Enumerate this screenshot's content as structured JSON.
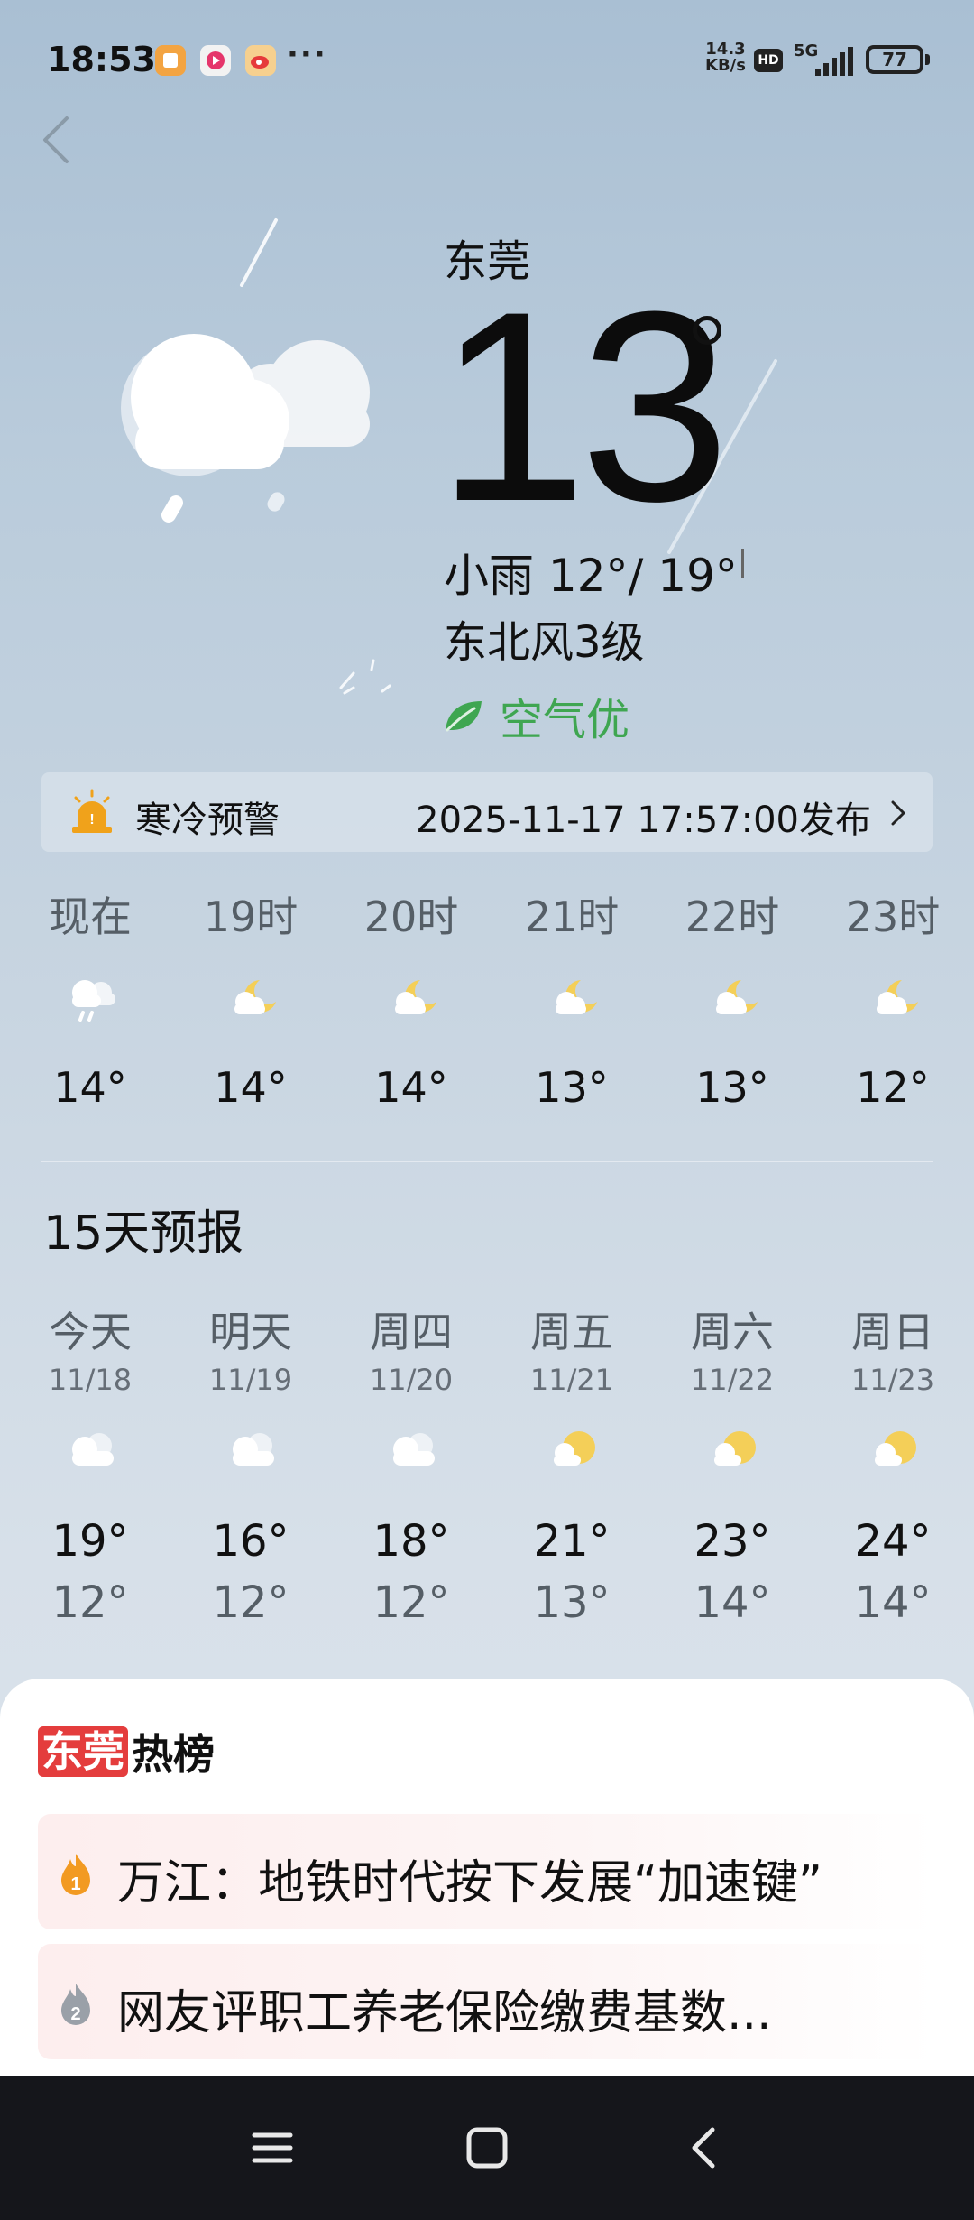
{
  "status_bar": {
    "time": "18:53",
    "net_speed_value": "14.3",
    "net_speed_unit": "KB/s",
    "hd_label": "HD",
    "network": "5G",
    "battery": "77",
    "more_icon": "···"
  },
  "current": {
    "city": "东莞",
    "temperature": "13",
    "condition": "小雨 12°/ 19°",
    "wind": "东北风3级",
    "air_quality": "空气优",
    "weather_icon": "cloud-rain-icon"
  },
  "warning": {
    "title": "寒冷预警",
    "published": "2025-11-17 17:57:00发布",
    "icon": "warning-lamp-icon"
  },
  "hourly": [
    {
      "label": "现在",
      "icon": "cloud-rain-icon",
      "temp": "14°"
    },
    {
      "label": "19时",
      "icon": "moon-cloud-icon",
      "temp": "14°"
    },
    {
      "label": "20时",
      "icon": "moon-cloud-icon",
      "temp": "14°"
    },
    {
      "label": "21时",
      "icon": "moon-cloud-icon",
      "temp": "13°"
    },
    {
      "label": "22时",
      "icon": "moon-cloud-icon",
      "temp": "13°"
    },
    {
      "label": "23时",
      "icon": "moon-cloud-icon",
      "temp": "12°"
    }
  ],
  "forecast": {
    "title": "15天预报",
    "days": [
      {
        "day": "今天",
        "date": "11/18",
        "icon": "cloudy-icon",
        "high": "19°",
        "low": "12°"
      },
      {
        "day": "明天",
        "date": "11/19",
        "icon": "cloudy-icon",
        "high": "16°",
        "low": "12°"
      },
      {
        "day": "周四",
        "date": "11/20",
        "icon": "cloudy-icon",
        "high": "18°",
        "low": "12°"
      },
      {
        "day": "周五",
        "date": "11/21",
        "icon": "sun-cloud-icon",
        "high": "21°",
        "low": "13°"
      },
      {
        "day": "周六",
        "date": "11/22",
        "icon": "sun-cloud-icon",
        "high": "23°",
        "low": "14°"
      },
      {
        "day": "周日",
        "date": "11/23",
        "icon": "sun-cloud-icon",
        "high": "24°",
        "low": "14°"
      }
    ]
  },
  "hot_list": {
    "badge": "东莞",
    "label": "热榜",
    "items": [
      {
        "rank": "1",
        "text": "万江：地铁时代按下发展“加速键”"
      },
      {
        "rank": "2",
        "text": "网友评职工养老保险缴费基数..."
      }
    ]
  },
  "colors": {
    "air_quality": "#3fa651",
    "hot_badge": "#e43d3d",
    "rank_1": "#f29a22",
    "rank_2": "#9aa0a8",
    "nav_bar": "#15161b"
  },
  "nav_bar": {
    "menu_icon": "menu-icon",
    "home_icon": "home-square-icon",
    "back_icon": "back-chevron-icon"
  }
}
